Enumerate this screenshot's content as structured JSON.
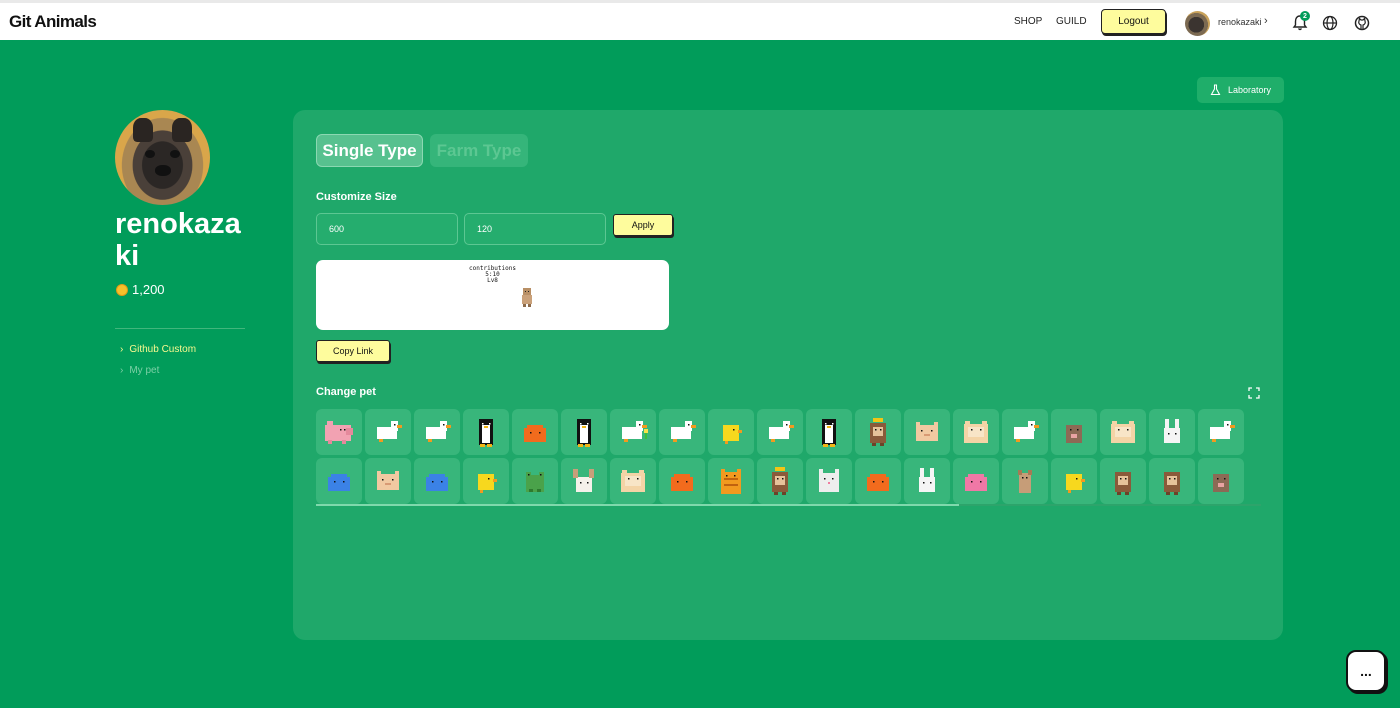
{
  "header": {
    "logo": "Git Animals",
    "nav": {
      "shop": "SHOP",
      "guild": "GUILD"
    },
    "logout_label": "Logout",
    "username": "renokazaki",
    "chevron": "›",
    "notification_count": "2",
    "icons": [
      "bell-icon",
      "globe-icon",
      "github-icon"
    ]
  },
  "profile": {
    "username": "renokazaki",
    "coins": "1,200"
  },
  "sidebar": {
    "items": [
      {
        "label": "Github Custom",
        "active": true
      },
      {
        "label": "My pet",
        "active": false
      }
    ],
    "chevron": "›"
  },
  "lab_button": {
    "label": "Laboratory"
  },
  "panel": {
    "tabs": [
      {
        "label": "Single Type",
        "active": true
      },
      {
        "label": "Farm Type",
        "active": false
      }
    ],
    "customize_size_label": "Customize Size",
    "width_value": "600",
    "height_value": "120",
    "apply_label": "Apply",
    "preview": {
      "line1": "contributions",
      "line2": "5:10",
      "line3": "Lv8"
    },
    "copy_link_label": "Copy Link",
    "change_pet_label": "Change pet",
    "scroll_fraction": 0.68
  },
  "pets_row1": [
    "pig",
    "goose",
    "goose",
    "penguin",
    "slime-orange",
    "penguin",
    "goose-flower",
    "goose",
    "chick",
    "goose",
    "penguin",
    "monkey-crown",
    "cat-tan",
    "hamster",
    "goose",
    "mole",
    "hamster",
    "rabbit",
    "goose"
  ],
  "pets_row2": [
    "slime-blue",
    "cat-tan",
    "slime-blue",
    "chick",
    "frog",
    "rabbit-brown",
    "hamster",
    "slime-orange",
    "tiger-cat",
    "monkey-crown",
    "cat-white",
    "slime-orange",
    "rabbit",
    "slime-pink",
    "dog-small",
    "chick",
    "monkey",
    "monkey",
    "mole"
  ],
  "colors": {
    "background": "#019c5a",
    "panel": "#1fa86a",
    "button_yellow": "#fefc9d",
    "active_link": "#f8f98f"
  },
  "chat_button": {
    "label": "..."
  }
}
